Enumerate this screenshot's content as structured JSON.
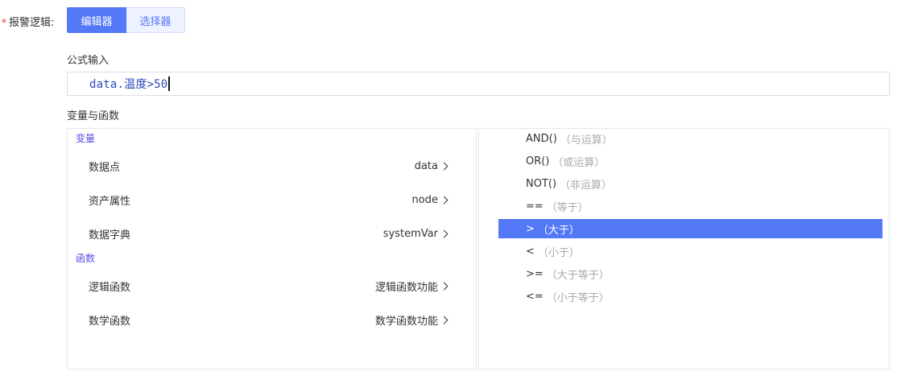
{
  "alarm_logic": {
    "required_mark": "*",
    "label": "报警逻辑:",
    "modes": [
      {
        "label": "编辑器",
        "active": true
      },
      {
        "label": "选择器",
        "active": false
      }
    ]
  },
  "formula": {
    "title": "公式输入",
    "value": "data.温度>50"
  },
  "vars_funcs": {
    "title": "变量与函数",
    "variables_group": "变量",
    "variables": [
      {
        "name": "数据点",
        "value": "data"
      },
      {
        "name": "资产属性",
        "value": "node"
      },
      {
        "name": "数据字典",
        "value": "systemVar"
      }
    ],
    "functions_group": "函数",
    "functions": [
      {
        "name": "逻辑函数",
        "value": "逻辑函数功能"
      },
      {
        "name": "数学函数",
        "value": "数学函数功能"
      }
    ]
  },
  "operators": [
    {
      "fn": "AND()",
      "desc": "（与运算）",
      "selected": false
    },
    {
      "fn": "OR()",
      "desc": "（或运算）",
      "selected": false
    },
    {
      "fn": "NOT()",
      "desc": "（非运算）",
      "selected": false
    },
    {
      "fn": "==",
      "desc": "（等于）",
      "selected": false
    },
    {
      "fn": ">",
      "desc": "（大于）",
      "selected": true
    },
    {
      "fn": "<",
      "desc": "（小于）",
      "selected": false
    },
    {
      "fn": ">=",
      "desc": "（大于等于）",
      "selected": false
    },
    {
      "fn": "<=",
      "desc": "（小于等于）",
      "selected": false
    }
  ],
  "colors": {
    "primary": "#5479f7",
    "group_title": "#5b4de6",
    "formula_text": "#2b48b8",
    "required": "#f5222d"
  }
}
